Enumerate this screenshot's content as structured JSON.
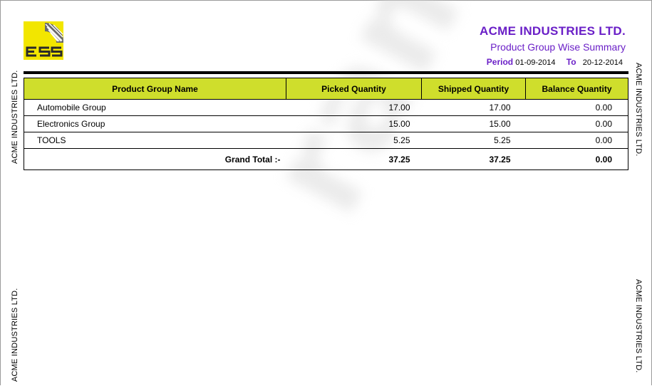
{
  "company": "ACME INDUSTRIES LTD.",
  "report_title": "Product Group Wise Summary",
  "period": {
    "label": "Period",
    "from": "01-09-2014",
    "to_label": "To",
    "to": "20-12-2014"
  },
  "side_label": "ACME INDUSTRIES LTD.",
  "watermark": "rame",
  "table": {
    "headers": [
      "Product Group Name",
      "Picked Quantity",
      "Shipped Quantity",
      "Balance Quantity"
    ],
    "rows": [
      {
        "name": "Automobile Group",
        "picked": "17.00",
        "shipped": "17.00",
        "balance": "0.00"
      },
      {
        "name": "Electronics Group",
        "picked": "15.00",
        "shipped": "15.00",
        "balance": "0.00"
      },
      {
        "name": "TOOLS",
        "picked": "5.25",
        "shipped": "5.25",
        "balance": "0.00"
      }
    ],
    "total": {
      "label": "Grand Total :-",
      "picked": "37.25",
      "shipped": "37.25",
      "balance": "0.00"
    }
  },
  "colors": {
    "accent": "#6a1fc7",
    "header_bg": "#cfde2c",
    "logo_bg": "#f2e600"
  }
}
